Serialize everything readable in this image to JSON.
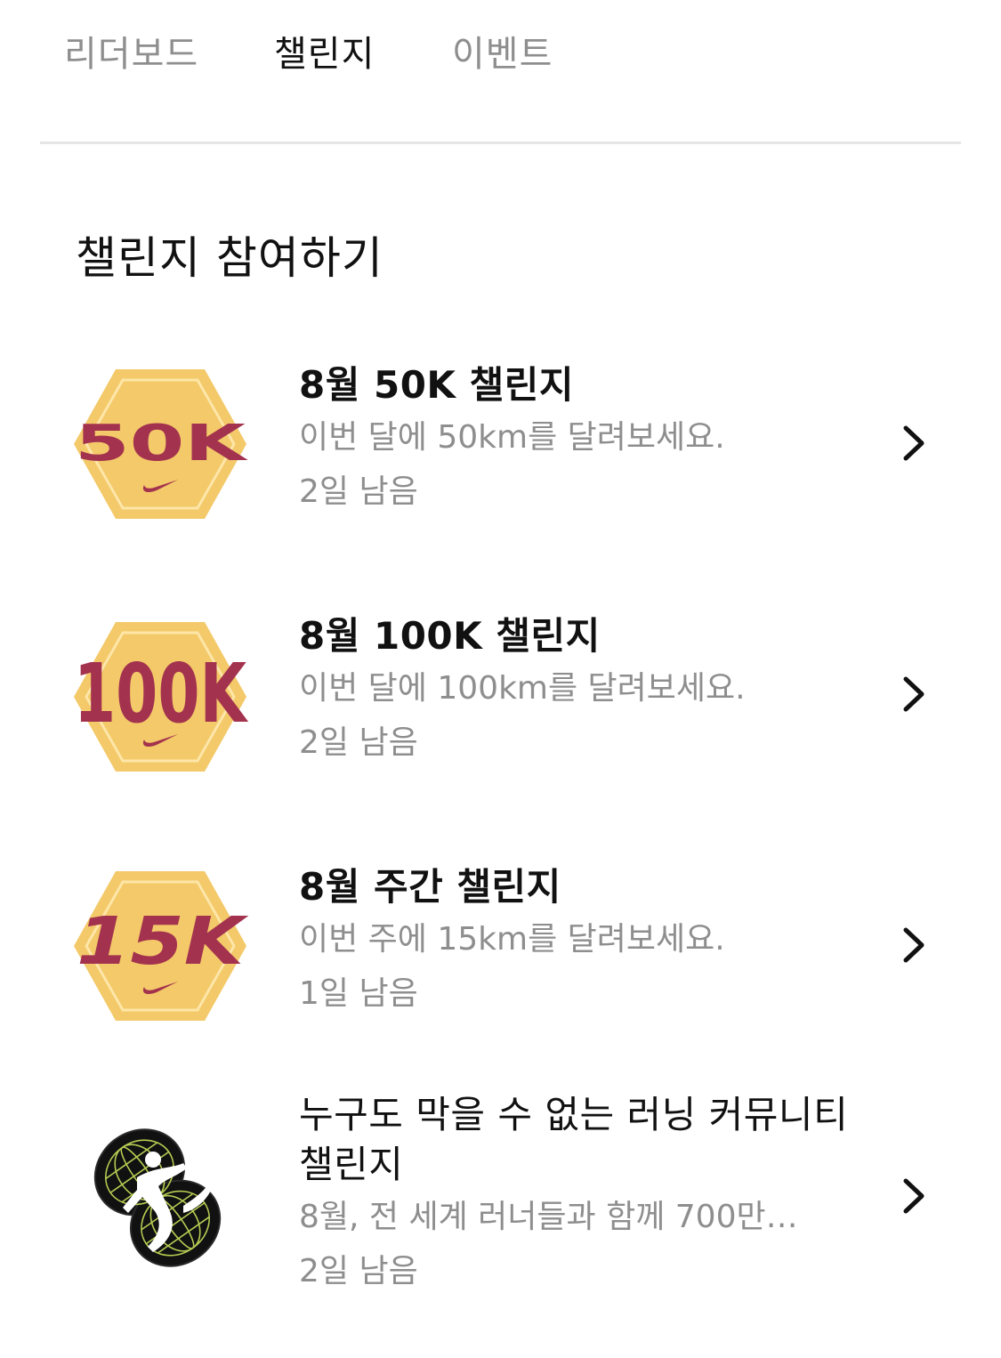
{
  "tabs": [
    {
      "label": "리더보드",
      "active": false
    },
    {
      "label": "챌린지",
      "active": true
    },
    {
      "label": "이벤트",
      "active": false
    }
  ],
  "section": {
    "title": "챌린지 참여하기"
  },
  "colors": {
    "badge_gold": "#f3c969",
    "badge_maroon": "#a3324f",
    "badge_outline": "#fde6a8",
    "community_badge_bg": "#111111",
    "community_badge_grid": "#c8e25a",
    "text_primary": "#111111",
    "text_secondary": "#8e8e8e",
    "divider": "#e5e5e5"
  },
  "challenges": [
    {
      "badge_text": "50K",
      "badge_icon": "swoosh-icon",
      "title": "8월 50K 챌린지",
      "description": "이번 달에 50km를 달려보세요.",
      "remaining": "2일 남음",
      "action_icon": "chevron-right-icon"
    },
    {
      "badge_text": "100K",
      "badge_icon": "swoosh-icon",
      "title": "8월 100K 챌린지",
      "description": "이번 달에 100km를 달려보세요.",
      "remaining": "2일 남음",
      "action_icon": "chevron-right-icon"
    },
    {
      "badge_text": "15K",
      "badge_icon": "swoosh-icon",
      "title": "8월 주간 챌린지",
      "description": "이번 주에 15km를 달려보세요.",
      "remaining": "1일 남음",
      "action_icon": "chevron-right-icon"
    },
    {
      "badge_icon": "runner-globe-icon",
      "title": "누구도 막을 수 없는 러닝 커뮤니티 챌린지",
      "description": "8월, 전 세계 러너들과 함께 700만…",
      "remaining": "2일 남음",
      "action_icon": "chevron-right-icon"
    }
  ]
}
